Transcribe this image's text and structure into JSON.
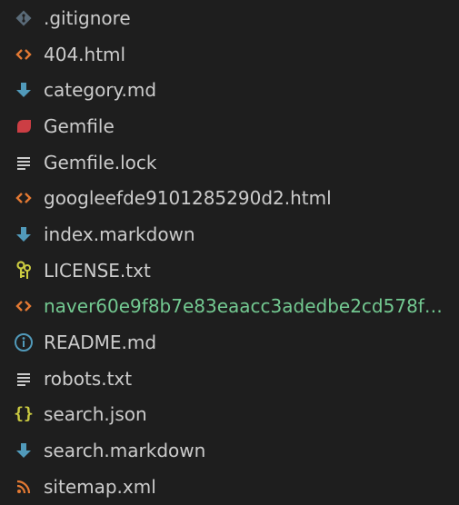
{
  "explorer": {
    "files": [
      {
        "name": ".gitignore",
        "icon": "git-icon",
        "color": "#5a6b79"
      },
      {
        "name": "404.html",
        "icon": "html-icon",
        "color": "#e37933"
      },
      {
        "name": "category.md",
        "icon": "markdown-icon",
        "color": "#519aba"
      },
      {
        "name": "Gemfile",
        "icon": "ruby-icon",
        "color": "#cc3e44"
      },
      {
        "name": "Gemfile.lock",
        "icon": "text-lines-icon",
        "color": "#cccccc"
      },
      {
        "name": "googleefde9101285290d2.html",
        "icon": "html-icon",
        "color": "#e37933"
      },
      {
        "name": "index.markdown",
        "icon": "markdown-icon",
        "color": "#519aba"
      },
      {
        "name": "LICENSE.txt",
        "icon": "license-icon",
        "color": "#cbcb41"
      },
      {
        "name": "naver60e9f8b7e83eaacc3adedbe2cd578f2...",
        "icon": "html-icon",
        "color": "#e37933",
        "status_color": "#73c991"
      },
      {
        "name": "README.md",
        "icon": "info-icon",
        "color": "#519aba"
      },
      {
        "name": "robots.txt",
        "icon": "text-lines-icon",
        "color": "#cccccc"
      },
      {
        "name": "search.json",
        "icon": "json-icon",
        "color": "#cbcb41"
      },
      {
        "name": "search.markdown",
        "icon": "markdown-icon",
        "color": "#519aba"
      },
      {
        "name": "sitemap.xml",
        "icon": "rss-icon",
        "color": "#e37933"
      }
    ]
  }
}
